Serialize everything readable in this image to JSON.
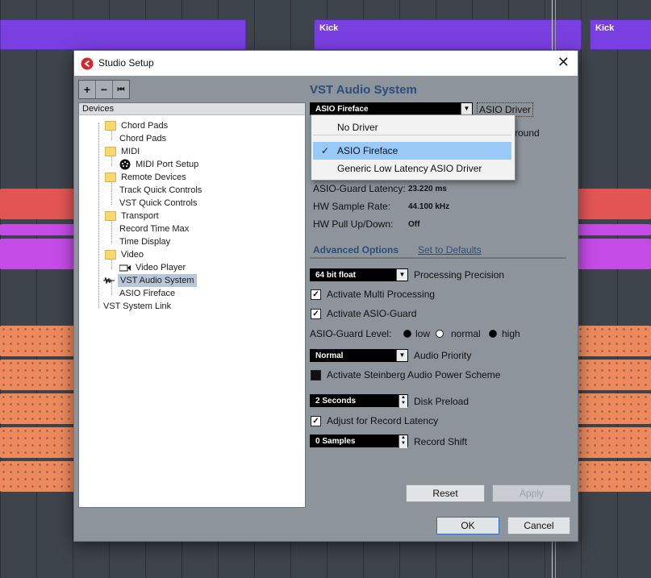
{
  "background": {
    "clip_labels": [
      "Kick",
      "Kick"
    ],
    "colors": {
      "purple": "#7a3fe0",
      "red": "#e35555",
      "magenta": "#c44be6",
      "orange": "#ec8a5e"
    }
  },
  "window": {
    "title": "Studio Setup",
    "close": "✕"
  },
  "toolbar": {
    "add": "+",
    "remove": "−",
    "reset": "⏮"
  },
  "devices": {
    "header": "Devices",
    "items": [
      "Chord Pads",
      "Chord Pads",
      "MIDI",
      "MIDI Port Setup",
      "Remote Devices",
      "Track Quick Controls",
      "VST Quick Controls",
      "Transport",
      "Record Time Max",
      "Time Display",
      "Video",
      "Video Player",
      "VST Audio System",
      "ASIO Fireface",
      "VST System Link"
    ]
  },
  "vst": {
    "title": "VST Audio System",
    "driver_value": "ASIO Fireface",
    "driver_button": "ASIO Driver",
    "partial_label": "round",
    "info": [
      {
        "label": "ASIO-Guard Latency:",
        "value": "23.220 ms"
      },
      {
        "label": "HW Sample Rate:",
        "value": "44.100 kHz"
      },
      {
        "label": "HW Pull Up/Down:",
        "value": "Off"
      }
    ],
    "advanced_options": "Advanced Options",
    "set_to_defaults": "Set to Defaults",
    "precision_value": "64 bit float",
    "precision_label": "Processing Precision",
    "multi_processing": "Activate Multi Processing",
    "asio_guard": "Activate ASIO-Guard",
    "asio_guard_level": "ASIO-Guard Level:",
    "levels": [
      "low",
      "normal",
      "high"
    ],
    "priority_value": "Normal",
    "priority_label": "Audio Priority",
    "power_scheme": "Activate Steinberg Audio Power Scheme",
    "disk_value": "2 Seconds",
    "disk_label": "Disk Preload",
    "adjust_latency": "Adjust for Record Latency",
    "shift_value": "0 Samples",
    "shift_label": "Record Shift",
    "reset": "Reset",
    "apply": "Apply",
    "ok": "OK",
    "cancel": "Cancel"
  },
  "menu": {
    "items": [
      "No Driver",
      "ASIO Fireface",
      "Generic Low Latency ASIO Driver"
    ],
    "check": "✓"
  }
}
